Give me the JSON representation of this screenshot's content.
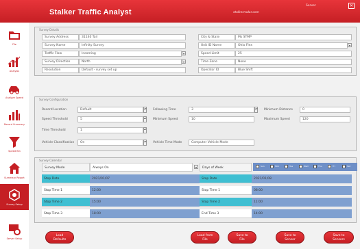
{
  "header": {
    "title": "Stalker Traffic Analyst",
    "url": "stalkerradar.com",
    "menu": "Server",
    "close": "✕"
  },
  "sidebar": {
    "items": [
      {
        "label": "File",
        "icon": "folder-icon"
      },
      {
        "label": "Analysis",
        "icon": "chart-icon"
      },
      {
        "label": "Analyze Speed",
        "icon": "car-icon"
      },
      {
        "label": "Record Summary",
        "icon": "bar-chart-icon"
      },
      {
        "label": "Speed Bin",
        "icon": "funnel-icon"
      },
      {
        "label": "Summary Report",
        "icon": "house-icon"
      },
      {
        "label": "Survey Setup",
        "icon": "setup-icon"
      },
      {
        "label": "Server Setup",
        "icon": "gear-icon"
      }
    ]
  },
  "survey_details": {
    "legend": "Survey Details",
    "left": [
      {
        "label": "Survey Address",
        "value": "31140 Tail"
      },
      {
        "label": "Survey Name",
        "value": "Infinity Survey"
      },
      {
        "label": "Traffic Flow",
        "value": "Incoming"
      },
      {
        "label": "Survey Direction",
        "value": "North"
      },
      {
        "label": "Resolution",
        "value": "Default - survey set up"
      }
    ],
    "right": [
      {
        "label": "City & State",
        "value": "Ms STMP"
      },
      {
        "label": "Unit ID Name",
        "value": "Ohio Flex"
      },
      {
        "label": "Speed Limit",
        "value": "25"
      },
      {
        "label": "Time Zone",
        "value": "None"
      },
      {
        "label": "Operator ID",
        "value": "Blue Shift"
      }
    ]
  },
  "survey_config": {
    "legend": "Survey Configuration",
    "rows": [
      [
        {
          "label": "Record Location",
          "value": "Default"
        },
        {
          "label": "Following Time",
          "value": "3"
        },
        {
          "label": "Minimum Distance",
          "value": "0"
        }
      ],
      [
        {
          "label": "Speed Threshold",
          "value": "5"
        },
        {
          "label": "Minimum Speed",
          "value": "10"
        },
        {
          "label": "Maximum Speed",
          "value": "120"
        }
      ],
      [
        {
          "label": "Time Threshold",
          "value": "1"
        }
      ],
      [
        {
          "label": "Vehicle Classification",
          "value": "On"
        },
        {
          "label": "Vehicle Time Mode",
          "value": "Computer Vehicle Mode"
        }
      ]
    ]
  },
  "survey_calendar": {
    "legend": "Survey Calendar",
    "survey_mode_label": "Survey Mode",
    "survey_mode_value": "Always On",
    "days_label": "Days of Week",
    "days": [
      "Sun",
      "Mon",
      "Tue",
      "Wed",
      "Thu",
      "Fri",
      "Sat"
    ],
    "left_rows": [
      {
        "label": "Stop Date",
        "value": "2021/01/07",
        "style": "teal"
      },
      {
        "label": "Stop Time 1",
        "value": "12:00",
        "style": "white"
      },
      {
        "label": "Stop Time 2",
        "value": "15:00",
        "style": "teal"
      },
      {
        "label": "Stop Time 3",
        "value": "18:00",
        "style": "white"
      }
    ],
    "right_rows": [
      {
        "label": "Stop Date",
        "value": "2021/01/08",
        "style": "teal"
      },
      {
        "label": "Stop Time 1",
        "value": "08:00",
        "style": "white"
      },
      {
        "label": "Stop Time 2",
        "value": "11:00",
        "style": "teal"
      },
      {
        "label": "End Time 3",
        "value": "14:00",
        "style": "white"
      }
    ]
  },
  "buttons": {
    "load_defaults": "Load\nDefaults",
    "load_from_file": "Load from\nFile",
    "save_to_file": "Save to\nFile",
    "save_to_sensor": "Save to\nSensor",
    "save_to_sensors": "Save to\nSensors"
  }
}
